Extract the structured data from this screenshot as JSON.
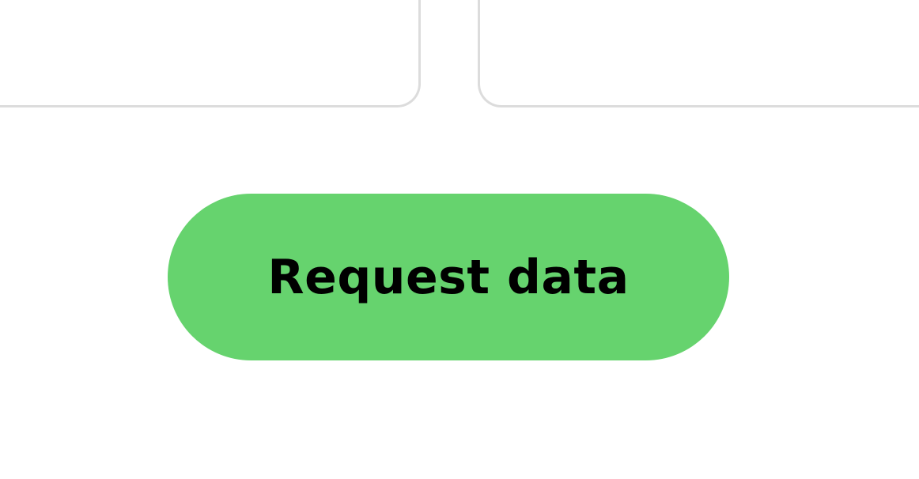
{
  "actions": {
    "request_button_label": "Request data"
  },
  "colors": {
    "button_bg": "#66d36e",
    "button_text": "#000000",
    "card_border": "#dcdcdc",
    "page_bg": "#ffffff"
  }
}
